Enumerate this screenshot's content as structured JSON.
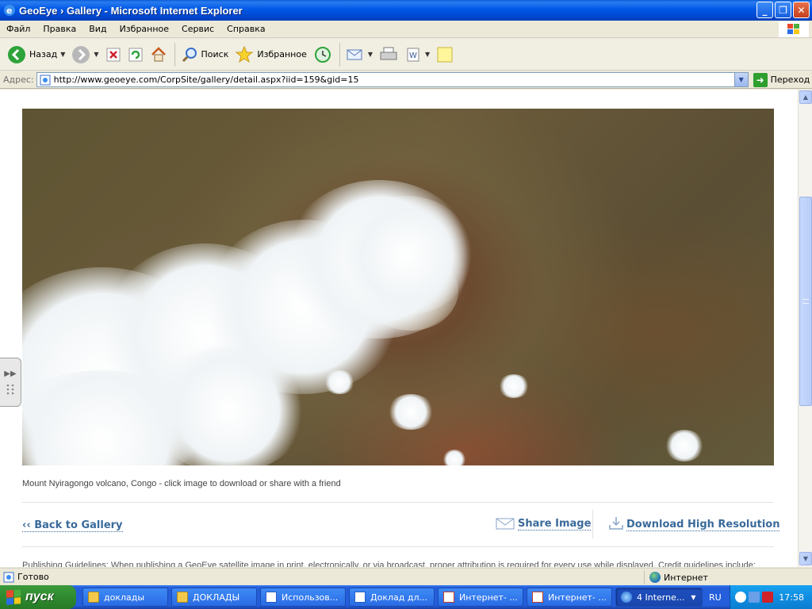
{
  "window": {
    "title": "GeoEye › Gallery - Microsoft Internet Explorer",
    "minimize": "_",
    "restore": "❐",
    "close": "✕"
  },
  "menu": [
    "Файл",
    "Правка",
    "Вид",
    "Избранное",
    "Сервис",
    "Справка"
  ],
  "toolbar": {
    "back_label": "Назад",
    "search_label": "Поиск",
    "favorites_label": "Избранное"
  },
  "address": {
    "label": "Адрес:",
    "url": "http://www.geoeye.com/CorpSite/gallery/detail.aspx?iid=159&gid=15",
    "go_label": "Переход"
  },
  "page": {
    "caption": "Mount Nyiragongo volcano, Congo - click image to download or share with a friend",
    "back_link": "‹‹ Back to Gallery",
    "share_link": "Share Image",
    "download_link": "Download High Resolution",
    "guidelines": "Publishing Guidelines: When publishing a GeoEye satellite image in print, electronically, or via broadcast, proper attribution is required for every use while displayed. Credit guidelines include:"
  },
  "status": {
    "text": "Готово",
    "zone": "Интернет"
  },
  "taskbar": {
    "start": "пуск",
    "tasks": [
      {
        "label": "доклады",
        "icon": "folder"
      },
      {
        "label": "ДОКЛАДЫ",
        "icon": "folder"
      },
      {
        "label": "Использов...",
        "icon": "doc"
      },
      {
        "label": "Доклад дл...",
        "icon": "doc"
      },
      {
        "label": "Интернет- ...",
        "icon": "ppt"
      },
      {
        "label": "Интернет- ...",
        "icon": "ppt"
      },
      {
        "label": "4 Interne...",
        "icon": "ie"
      }
    ],
    "lang": "RU",
    "clock": "17:58"
  }
}
